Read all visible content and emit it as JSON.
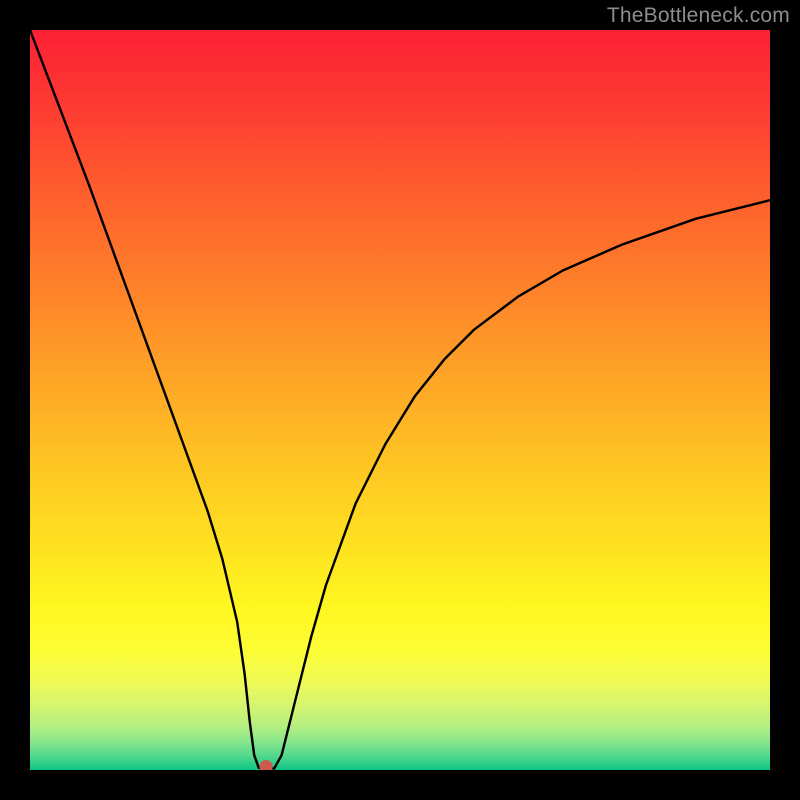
{
  "watermark": {
    "text": "TheBottleneck.com"
  },
  "chart_data": {
    "type": "line",
    "title": "",
    "xlabel": "",
    "ylabel": "",
    "xlim": [
      0,
      100
    ],
    "ylim": [
      0,
      100
    ],
    "grid": false,
    "legend": false,
    "series": [
      {
        "name": "curve",
        "x": [
          0,
          4,
          8,
          12,
          16,
          20,
          24,
          26,
          28,
          29,
          29.7,
          30.3,
          30.9,
          31.5,
          32,
          33,
          34,
          36,
          38,
          40,
          44,
          48,
          52,
          56,
          60,
          66,
          72,
          80,
          90,
          100
        ],
        "y": [
          100,
          89.5,
          79,
          68,
          57,
          46,
          35,
          28.5,
          20,
          13,
          6.5,
          2,
          0.3,
          0.2,
          0.2,
          0.2,
          2,
          10,
          18,
          25,
          36,
          44,
          50.5,
          55.5,
          59.5,
          64,
          67.5,
          71,
          74.5,
          77
        ]
      }
    ],
    "marker": {
      "x": 31.9,
      "y": 0.45,
      "color": "#cd5a4e",
      "r": 0.9
    },
    "colors": {
      "gradient_top": "#fc2034",
      "gradient_mid": "#fee220",
      "gradient_bottom": "#0fc686",
      "curve": "#000000",
      "frame": "#000000"
    }
  }
}
